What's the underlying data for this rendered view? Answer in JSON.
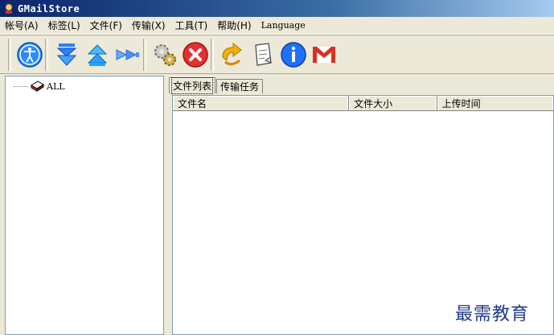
{
  "window": {
    "title": "GMailStore"
  },
  "menu": [
    {
      "label": "帐号(A)"
    },
    {
      "label": "标签(L)"
    },
    {
      "label": "文件(F)"
    },
    {
      "label": "传输(X)"
    },
    {
      "label": "工具(T)"
    },
    {
      "label": "帮助(H)"
    },
    {
      "label": "Language"
    }
  ],
  "toolbar": {
    "buttons": [
      {
        "icon": "accessibility-icon",
        "color": "#1e90ff"
      },
      {
        "icon": "download-icon",
        "color": "#2a7fff"
      },
      {
        "icon": "upload-icon",
        "color": "#2a9fff"
      },
      {
        "icon": "forward-icon",
        "color": "#5aa0ff"
      },
      {
        "icon": "gears-icon",
        "color": "#a0a0a0"
      },
      {
        "icon": "stop-icon",
        "color": "#e02020"
      },
      {
        "icon": "refresh-icon",
        "color": "#f0a000"
      },
      {
        "icon": "note-icon",
        "color": "#ffffff"
      },
      {
        "icon": "info-icon",
        "color": "#1e70ff"
      },
      {
        "icon": "gmail-icon",
        "color": "#d93025"
      }
    ]
  },
  "tree": {
    "root_label": "ALL"
  },
  "tabs": [
    {
      "label": "文件列表",
      "active": true
    },
    {
      "label": "传输任务",
      "active": false
    }
  ],
  "list": {
    "columns": [
      {
        "label": "文件名"
      },
      {
        "label": "文件大小"
      },
      {
        "label": "上传时间"
      }
    ]
  },
  "watermark": "最需教育"
}
